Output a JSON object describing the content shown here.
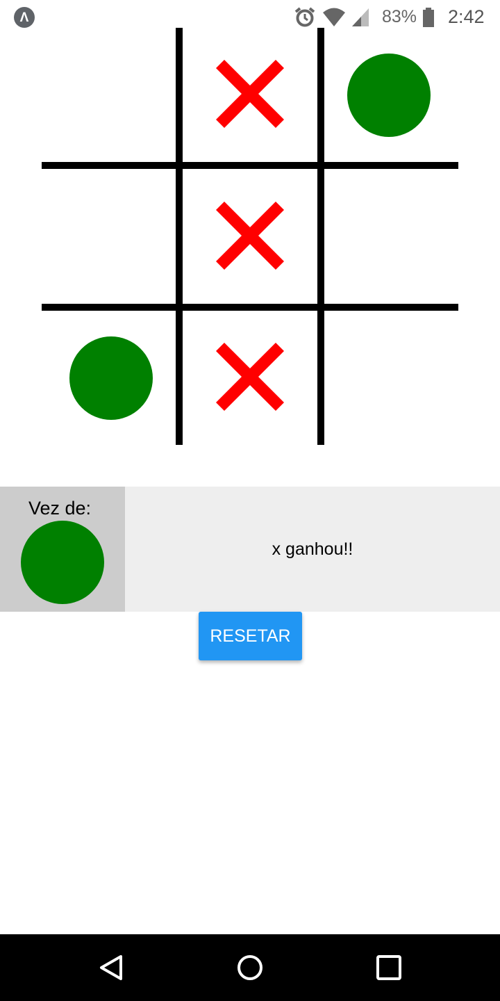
{
  "status_bar": {
    "app_icon_glyph": "Λ",
    "icons": [
      "alarm-icon",
      "wifi-icon",
      "cell-signal-icon",
      "battery-icon"
    ],
    "battery_percent": "83%",
    "time": "2:42"
  },
  "board": {
    "cells": [
      "",
      "x",
      "o",
      "",
      "x",
      "",
      "o",
      "x",
      ""
    ],
    "x_color": "#ff0000",
    "o_color": "#008000",
    "line_color": "#000000"
  },
  "turn": {
    "label": "Vez de:",
    "player": "o"
  },
  "result": {
    "message": "x ganhou!!"
  },
  "reset_button": {
    "label": "RESETAR",
    "color": "#2196f3"
  },
  "nav_bar": {
    "buttons": [
      "back-icon",
      "home-icon",
      "recents-icon"
    ]
  }
}
